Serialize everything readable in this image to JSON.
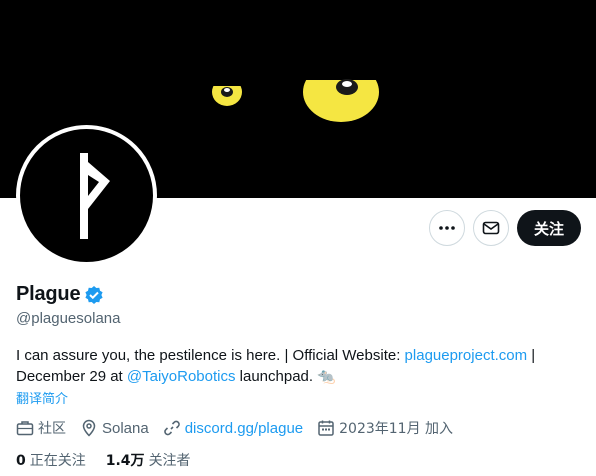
{
  "profile": {
    "name": "Plague",
    "verified": true,
    "handle": "@plaguesolana",
    "bio": {
      "text_1": "I can assure you, the pestilence is here. | Official Website: ",
      "link_1": "plagueproject.com",
      "text_2": " |",
      "text_3": "December 29 at ",
      "mention": "@TaiyoRobotics",
      "text_4": " launchpad. ",
      "emoji": "🐀"
    },
    "translate_label": "翻译简介",
    "meta": {
      "category": "社区",
      "location": "Solana",
      "website": "discord.gg/plague",
      "joined": "2023年11月 加入"
    },
    "stats": {
      "following_count": "0",
      "following_label": "正在关注",
      "followers_count": "1.4万",
      "followers_label": "关注者"
    }
  },
  "actions": {
    "more_icon": "more-icon",
    "message_icon": "envelope-icon",
    "follow_label": "关注"
  },
  "colors": {
    "accent": "#1d9bf0",
    "text": "#0f1419",
    "muted": "#536471",
    "verified": "#1d9bf0",
    "banner_eye": "#f5e642"
  }
}
